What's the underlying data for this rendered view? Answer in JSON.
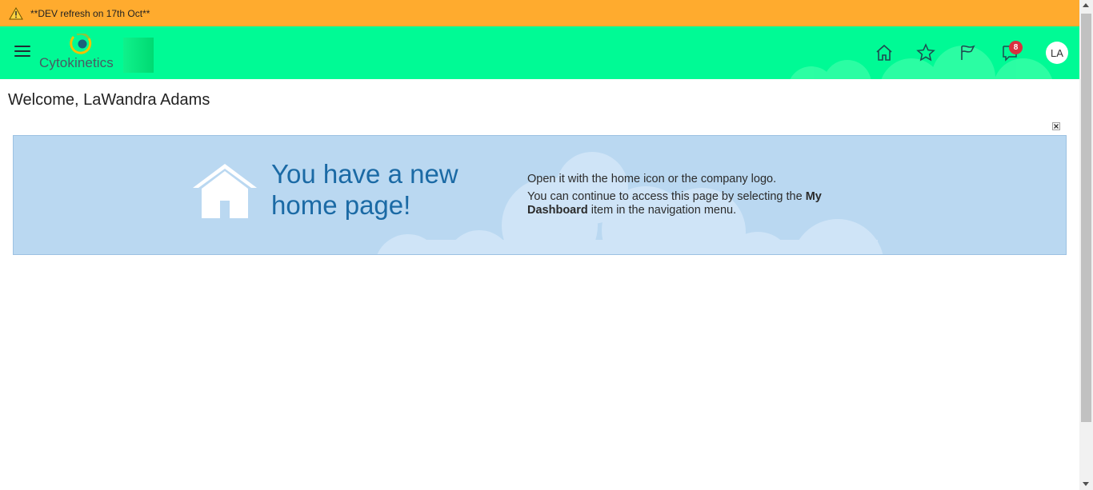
{
  "dev_banner": {
    "icon": "warning-icon",
    "text": "**DEV refresh on 17th Oct**"
  },
  "header": {
    "menu_icon": "hamburger-menu-icon",
    "logo_text": "Cytokinetics",
    "icons": [
      "home-icon",
      "star-icon",
      "flag-icon",
      "notifications-icon"
    ],
    "notification_count": "8",
    "avatar_initials": "LA"
  },
  "welcome": "Welcome, LaWandra Adams",
  "info_banner": {
    "headline_line1": "You have a new",
    "headline_line2": "home page!",
    "line1": "Open it with the home icon or the company logo.",
    "line2_pre": "You can continue to access this page by selecting the ",
    "line2_bold1": "My",
    "line2_bold2": "Dashboard",
    "line2_post": " item in the navigation menu."
  },
  "colors": {
    "dev_banner": "#ffab2e",
    "header": "#00fa95",
    "banner_bg": "#bad8f1",
    "headline": "#1b6aa5",
    "badge": "#d9303f"
  }
}
